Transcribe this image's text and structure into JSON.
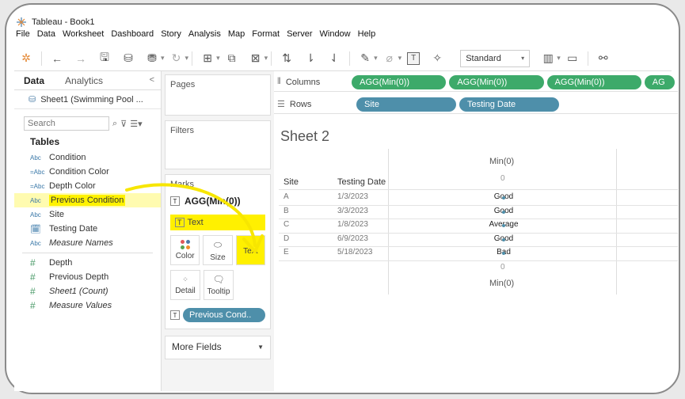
{
  "app": {
    "title": "Tableau - Book1",
    "menu": [
      "File",
      "Data",
      "Worksheet",
      "Dashboard",
      "Story",
      "Analysis",
      "Map",
      "Format",
      "Server",
      "Window",
      "Help"
    ]
  },
  "toolbar": {
    "fit_select": "Standard",
    "icons": [
      "tableau-logo-icon",
      "undo-icon",
      "redo-icon",
      "save-icon",
      "new-datasource-icon",
      "pause-icon",
      "refresh-icon",
      "new-worksheet-icon",
      "duplicate-icon",
      "clear-sheet-icon",
      "swap-icon",
      "sort-ascending-icon",
      "sort-descending-icon",
      "highlight-icon",
      "group-icon",
      "show-mark-labels-icon",
      "pin-icon",
      "show-me-icon",
      "presentation-icon",
      "share-icon"
    ]
  },
  "data_pane": {
    "tab_data": "Data",
    "tab_analytics": "Analytics",
    "collapse_glyph": "<",
    "datasource": "Sheet1 (Swimming Pool ...",
    "search_placeholder": "Search",
    "tables_heading": "Tables",
    "fields": [
      {
        "type": "Abc",
        "label": "Condition"
      },
      {
        "type": "=Abc",
        "label": "Condition Color"
      },
      {
        "type": "=Abc",
        "label": "Depth Color"
      },
      {
        "type": "Abc",
        "label": "Previous Condition",
        "highlight": true
      },
      {
        "type": "Abc",
        "label": "Site"
      },
      {
        "type": "date",
        "label": "Testing Date"
      },
      {
        "type": "Abc",
        "label": "Measure Names",
        "italic": true
      }
    ],
    "measures": [
      {
        "type": "#",
        "label": "Depth"
      },
      {
        "type": "#",
        "label": "Previous Depth"
      },
      {
        "type": "#",
        "label": "Sheet1 (Count)",
        "italic": true
      },
      {
        "type": "#",
        "label": "Measure Values",
        "italic": true
      }
    ]
  },
  "cards": {
    "pages": "Pages",
    "filters": "Filters",
    "marks": "Marks",
    "marks_field": "AGG(Min(0))",
    "marks_type": "Text",
    "buttons": {
      "color": "Color",
      "size": "Size",
      "text": "Text",
      "detail": "Detail",
      "tooltip": "Tooltip"
    },
    "previous_pill": "Previous Cond..",
    "more_fields": "More Fields"
  },
  "shelves": {
    "columns_label": "Columns",
    "rows_label": "Rows",
    "column_pills": [
      "AGG(Min(0))",
      "AGG(Min(0))",
      "AGG(Min(0))",
      "AG"
    ],
    "row_pills": [
      "Site",
      "Testing Date"
    ]
  },
  "view": {
    "sheet_title": "Sheet 2",
    "axis_top_label": "Min(0)",
    "axis_bottom_label": "Min(0)",
    "tick_zero": "0",
    "headers": {
      "site": "Site",
      "date": "Testing Date"
    },
    "rows": [
      {
        "site": "A",
        "date": "1/3/2023",
        "value": "Good"
      },
      {
        "site": "B",
        "date": "3/3/2023",
        "value": "Good"
      },
      {
        "site": "C",
        "date": "1/8/2023",
        "value": "Average"
      },
      {
        "site": "D",
        "date": "6/9/2023",
        "value": "Good"
      },
      {
        "site": "E",
        "date": "5/18/2023",
        "value": "Bad"
      }
    ]
  },
  "colors": {
    "pill_green": "#3daa6a",
    "pill_blue": "#4e8faa",
    "highlight_yellow": "#fff000"
  }
}
